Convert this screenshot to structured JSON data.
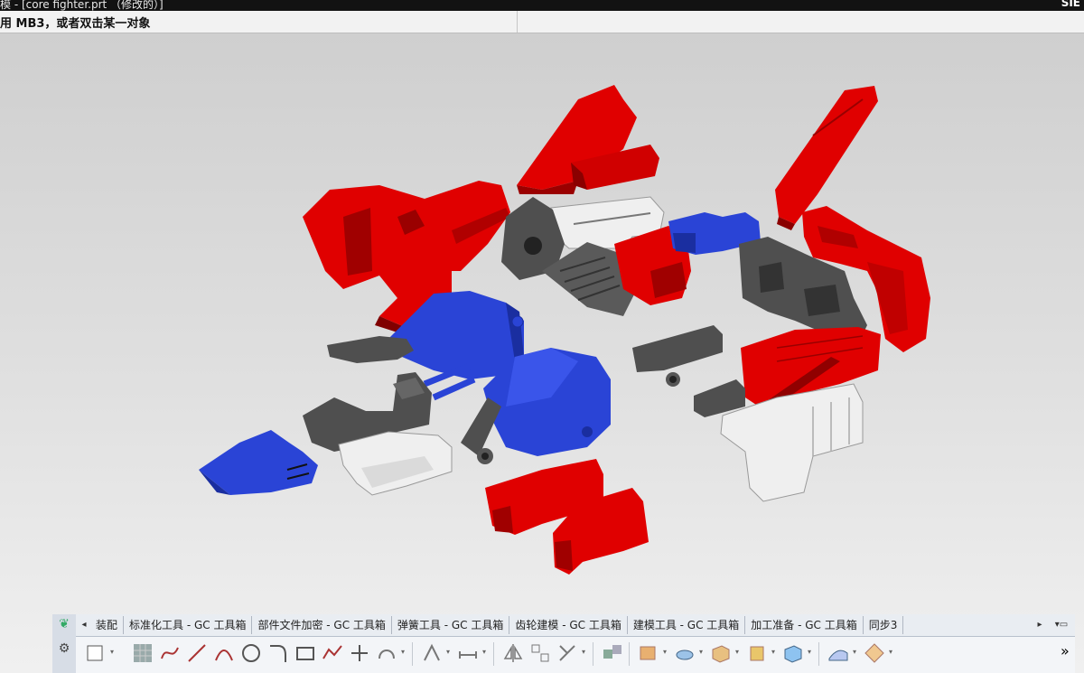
{
  "window": {
    "title": "模 - [core fighter.prt （修改的）]",
    "brand": "SIE"
  },
  "status": {
    "message": "用 MB3，或者双击某一对象"
  },
  "toolbar_tabs": [
    "装配",
    "标准化工具 - GC 工具箱",
    "部件文件加密 - GC 工具箱",
    "弹簧工具 - GC 工具箱",
    "齿轮建模 - GC 工具箱",
    "建模工具 - GC 工具箱",
    "加工准备 - GC 工具箱",
    "同步3"
  ],
  "icons": {
    "tab_prev": "◂",
    "tab_next": "▸",
    "dock_menu": "▾▭",
    "overflow": "»"
  },
  "colors": {
    "part_red": "#e00000",
    "part_blue": "#2a44d6",
    "part_gray": "#505050",
    "part_white": "#efefef"
  }
}
